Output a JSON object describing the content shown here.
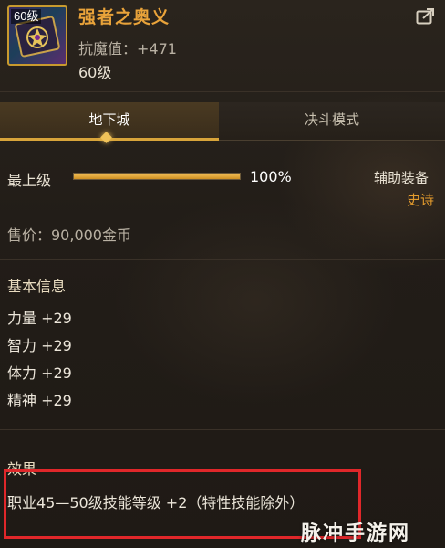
{
  "item": {
    "level_badge": "60级",
    "name": "强者之奥义",
    "stat": "抗魔值：+471",
    "level": "60级"
  },
  "tabs": [
    {
      "label": "地下城",
      "active": true
    },
    {
      "label": "决斗模式",
      "active": false
    }
  ],
  "max_level": {
    "label": "最上级",
    "progress_percent": 100,
    "percent_text": "100%"
  },
  "aux": {
    "label": "辅助装备",
    "rarity": "史诗"
  },
  "price": "售价：90,000金币",
  "basic_info": {
    "title": "基本信息",
    "stats": [
      "力量 +29",
      "智力 +29",
      "体力 +29",
      "精神 +29"
    ]
  },
  "effect": {
    "title": "效果",
    "text": "职业45—50级技能等级 +2（特性技能除外）"
  },
  "watermark": "脉冲手游网",
  "colors": {
    "item_name": "#e9a33a",
    "rarity": "#e39b2d",
    "highlight": "#e0272a",
    "tab_accent": "#d8a43a"
  }
}
